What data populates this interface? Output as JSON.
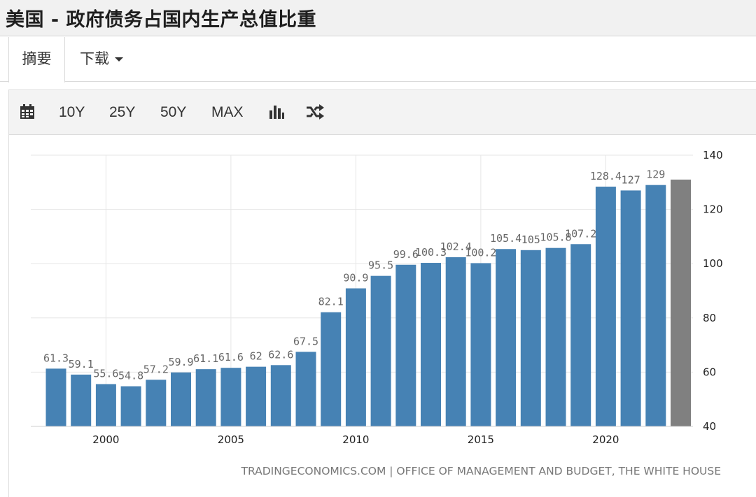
{
  "page": {
    "title": "美国 - 政府债务占国内生产总值比重"
  },
  "tabs": [
    {
      "label": "摘要",
      "active": true
    },
    {
      "label": "下载",
      "dropdown": true
    }
  ],
  "toolbar": {
    "items": [
      {
        "label": "",
        "icon": "calendar-icon"
      },
      {
        "label": "10Y"
      },
      {
        "label": "25Y"
      },
      {
        "label": "50Y"
      },
      {
        "label": "MAX"
      },
      {
        "label": "",
        "icon": "bar-chart-icon"
      },
      {
        "label": "",
        "icon": "shuffle-icon"
      }
    ]
  },
  "chart_data": {
    "type": "bar",
    "title": "",
    "xlabel": "",
    "ylabel": "",
    "ylim": [
      40,
      140
    ],
    "yticks": [
      40,
      60,
      80,
      100,
      120,
      140
    ],
    "y_axis_side": "right",
    "xticks": [
      2000,
      2005,
      2010,
      2015,
      2020
    ],
    "grid": true,
    "series": [
      {
        "color": "#4682b4",
        "x": [
          1998,
          1999,
          2000,
          2001,
          2002,
          2003,
          2004,
          2005,
          2006,
          2007,
          2008,
          2009,
          2010,
          2011,
          2012,
          2013,
          2014,
          2015,
          2016,
          2017,
          2018,
          2019,
          2020,
          2021,
          2022
        ],
        "values": [
          61.3,
          59.1,
          55.6,
          54.8,
          57.2,
          59.9,
          61.1,
          61.6,
          62,
          62.6,
          67.5,
          82.1,
          90.9,
          95.5,
          99.6,
          100.3,
          102.4,
          100.2,
          105.4,
          105,
          105.8,
          107.2,
          128.4,
          127,
          129
        ],
        "labels": [
          "61.3",
          "59.1",
          "55.6",
          "54.8",
          "57.2",
          "59.9",
          "61.1",
          "61.6",
          "62",
          "62.6",
          "67.5",
          "82.1",
          "90.9",
          "95.5",
          "99.6",
          "100.3",
          "102.4",
          "100.2",
          "105.4",
          "105",
          "105.8",
          "107.2",
          "128.4",
          "127",
          "129"
        ]
      },
      {
        "color": "#808080",
        "x": [
          2023
        ],
        "values": [
          131
        ],
        "labels": [
          ""
        ]
      }
    ],
    "source": "TRADINGECONOMICS.COM  |  OFFICE OF MANAGEMENT AND BUDGET, THE WHITE HOUSE"
  }
}
